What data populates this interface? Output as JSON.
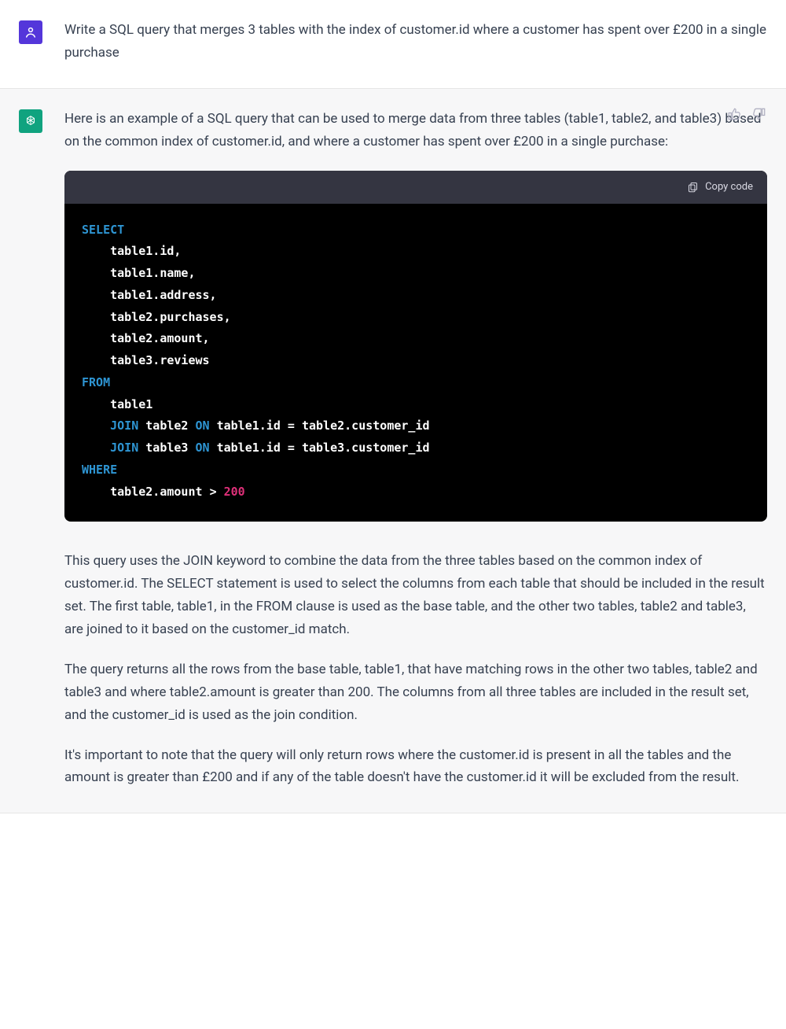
{
  "user": {
    "message": "Write a SQL query that merges 3 tables with the index of customer.id where a customer has spent over £200 in a single purchase"
  },
  "assistant": {
    "intro": "Here is an example of a SQL query that can be used to merge data from three tables (table1, table2, and table3) based on the common index of customer.id, and where a customer has spent over £200 in a single purchase:",
    "code": {
      "copy_label": "Copy code",
      "tokens": [
        {
          "t": "kw",
          "v": "SELECT"
        },
        {
          "t": "nl"
        },
        {
          "t": "indent"
        },
        {
          "t": "id",
          "v": "table1.id,"
        },
        {
          "t": "nl"
        },
        {
          "t": "indent"
        },
        {
          "t": "id",
          "v": "table1.name,"
        },
        {
          "t": "nl"
        },
        {
          "t": "indent"
        },
        {
          "t": "id",
          "v": "table1.address,"
        },
        {
          "t": "nl"
        },
        {
          "t": "indent"
        },
        {
          "t": "id",
          "v": "table2.purchases,"
        },
        {
          "t": "nl"
        },
        {
          "t": "indent"
        },
        {
          "t": "id",
          "v": "table2.amount,"
        },
        {
          "t": "nl"
        },
        {
          "t": "indent"
        },
        {
          "t": "id",
          "v": "table3.reviews"
        },
        {
          "t": "nl"
        },
        {
          "t": "kw",
          "v": "FROM"
        },
        {
          "t": "nl"
        },
        {
          "t": "indent"
        },
        {
          "t": "id",
          "v": "table1"
        },
        {
          "t": "nl"
        },
        {
          "t": "indent"
        },
        {
          "t": "kw",
          "v": "JOIN"
        },
        {
          "t": "sp"
        },
        {
          "t": "id",
          "v": "table2"
        },
        {
          "t": "sp"
        },
        {
          "t": "kw",
          "v": "ON"
        },
        {
          "t": "sp"
        },
        {
          "t": "id",
          "v": "table1.id"
        },
        {
          "t": "sp"
        },
        {
          "t": "op",
          "v": "="
        },
        {
          "t": "sp"
        },
        {
          "t": "id",
          "v": "table2.customer_id"
        },
        {
          "t": "nl"
        },
        {
          "t": "indent"
        },
        {
          "t": "kw",
          "v": "JOIN"
        },
        {
          "t": "sp"
        },
        {
          "t": "id",
          "v": "table3"
        },
        {
          "t": "sp"
        },
        {
          "t": "kw",
          "v": "ON"
        },
        {
          "t": "sp"
        },
        {
          "t": "id",
          "v": "table1.id"
        },
        {
          "t": "sp"
        },
        {
          "t": "op",
          "v": "="
        },
        {
          "t": "sp"
        },
        {
          "t": "id",
          "v": "table3.customer_id"
        },
        {
          "t": "nl"
        },
        {
          "t": "kw",
          "v": "WHERE"
        },
        {
          "t": "nl"
        },
        {
          "t": "indent"
        },
        {
          "t": "id",
          "v": "table2.amount"
        },
        {
          "t": "sp"
        },
        {
          "t": "op",
          "v": ">"
        },
        {
          "t": "sp"
        },
        {
          "t": "num",
          "v": "200"
        }
      ]
    },
    "paragraphs": [
      "This query uses the JOIN keyword to combine the data from the three tables based on the common index of customer.id. The SELECT statement is used to select the columns from each table that should be included in the result set. The first table, table1, in the FROM clause is used as the base table, and the other two tables, table2 and table3, are joined to it based on the customer_id match.",
      "The query returns all the rows from the base table, table1, that have matching rows in the other two tables, table2 and table3 and where table2.amount is greater than 200. The columns from all three tables are included in the result set, and the customer_id is used as the join condition.",
      "It's important to note that the query will only return rows where the customer.id is present in all the tables and the amount is greater than £200 and if any of the table doesn't have the customer.id it will be excluded from the result."
    ]
  }
}
